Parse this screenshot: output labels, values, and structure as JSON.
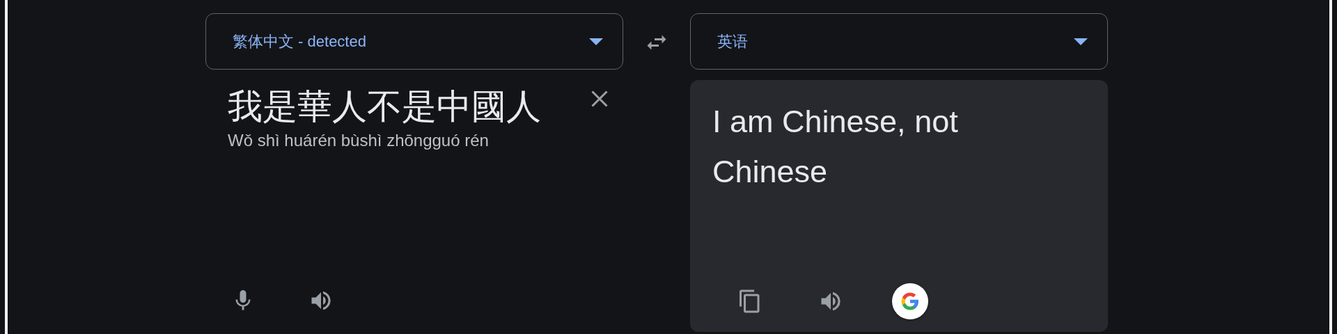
{
  "source": {
    "language": "繁体中文 - detected",
    "text": "我是華人不是中國人",
    "romanization": "Wǒ shì huárén bùshì zhōngguó rén"
  },
  "target": {
    "language": "英语",
    "text": "I am Chinese, not Chinese"
  }
}
